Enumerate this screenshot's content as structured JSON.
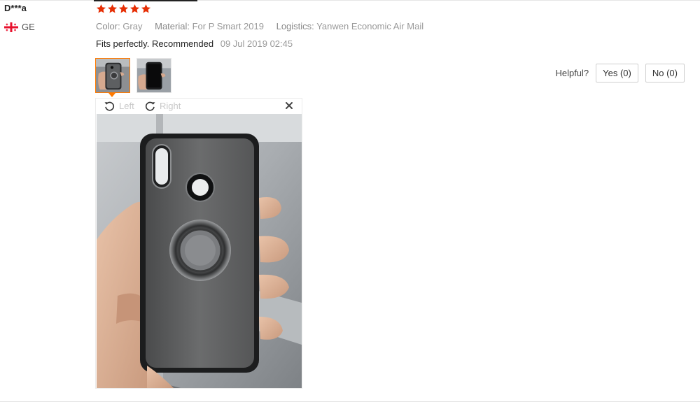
{
  "buyer": {
    "name": "D***a",
    "country": "GE",
    "flag_icon": "georgia-flag-icon"
  },
  "rating": {
    "stars": 5,
    "max": 5,
    "color": "#e62e04"
  },
  "attributes": [
    {
      "key": "Color:",
      "value": "Gray"
    },
    {
      "key": "Material:",
      "value": "For P Smart 2019"
    },
    {
      "key": "Logistics:",
      "value": "Yanwen Economic Air Mail"
    }
  ],
  "review": {
    "text": "Fits perfectly. Recommended",
    "date": "09 Jul 2019 02:45"
  },
  "viewer": {
    "rotate_left": "Left",
    "rotate_right": "Right",
    "close_icon": "close-icon"
  },
  "helpful": {
    "label": "Helpful?",
    "yes": "Yes (0)",
    "no": "No (0)"
  },
  "colors": {
    "accent": "#ff7a00",
    "star": "#e62e04",
    "border": "#cfcfcf"
  }
}
